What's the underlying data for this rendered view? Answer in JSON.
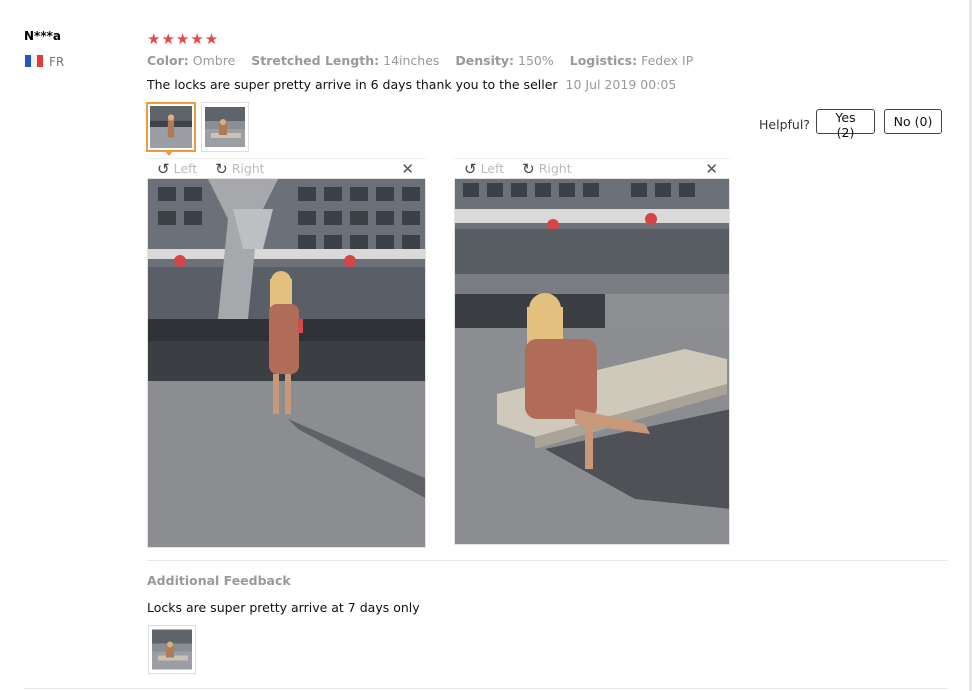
{
  "user": {
    "name": "N***a",
    "country": "FR",
    "flag_colors": [
      "#2457c5",
      "#ffffff",
      "#e33b3b"
    ]
  },
  "rating": {
    "stars": "★★★★★",
    "color": "#e8484a"
  },
  "attributes": [
    {
      "key": "Color:",
      "value": "Ombre"
    },
    {
      "key": "Stretched Length:",
      "value": "14inches"
    },
    {
      "key": "Density:",
      "value": "150%"
    },
    {
      "key": "Logistics:",
      "value": "Fedex IP"
    }
  ],
  "review": {
    "text": "The locks are super pretty arrive in 6 days thank you to the seller",
    "date": "10 Jul 2019 00:05"
  },
  "helpful": {
    "label": "Helpful?",
    "yes": "Yes (2)",
    "no": "No (0)"
  },
  "viewer": {
    "left_label": "Left",
    "right_label": "Right",
    "rotate_left_icon": "↺",
    "rotate_right_icon": "↻",
    "close_icon": "✕"
  },
  "additional": {
    "title": "Additional Feedback",
    "text": "Locks are super pretty arrive at 7 days only"
  },
  "colors": {
    "accent": "#f39a3c",
    "muted": "#999999"
  }
}
